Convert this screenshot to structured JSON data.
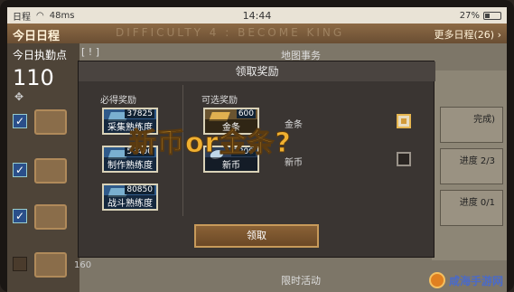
{
  "status_bar": {
    "carrier": "日程",
    "network": "48ms",
    "time": "14:44",
    "battery": "27%"
  },
  "header": {
    "title": "今日日程",
    "more_label": "更多日程(26)",
    "ticker": "DIFFICULTY 4 : BECOME KING"
  },
  "left_panel": {
    "points_label": "今日执勤点",
    "bracket": "[ ! ]",
    "points_value": "110",
    "footer_value": "160"
  },
  "background": {
    "top_heading": "地图事务",
    "bottom_heading": "限时活动",
    "right_items": [
      {
        "status": "完成)"
      },
      {
        "status": "进度 2/3"
      },
      {
        "status": "进度 0/1"
      }
    ]
  },
  "modal": {
    "title": "领取奖励",
    "required_label": "必得奖励",
    "optional_label": "可选奖励",
    "required_items": [
      {
        "name": "采集熟练度",
        "count": "37825"
      },
      {
        "name": "制作熟练度",
        "count": "57400"
      },
      {
        "name": "战斗熟练度",
        "count": "80850"
      }
    ],
    "optional_items": [
      {
        "name": "金条",
        "count": "600",
        "label": "金条",
        "checked": true
      },
      {
        "name": "新币",
        "count": "1200",
        "label": "新币",
        "checked": false
      }
    ],
    "claim_label": "领取"
  },
  "overlay_text": "新币or金条?",
  "watermark": "咸海手游网",
  "colors": {
    "accent_gold": "#f0b030",
    "button_brown": "#8a6236",
    "selected_check": "#e6b650"
  }
}
